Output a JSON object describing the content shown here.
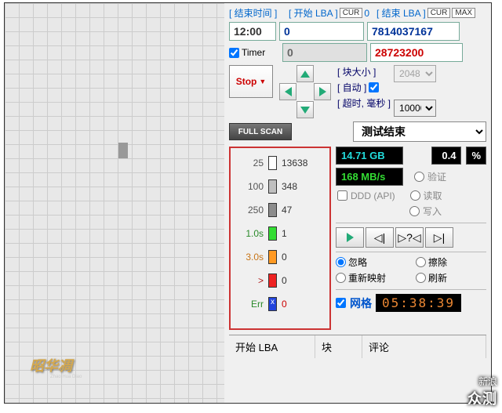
{
  "top": {
    "end_time_label": "[ 结束时间 ]",
    "start_lba_label": "[ 开始 LBA ]",
    "cur1": "CUR",
    "cur1_val": "0",
    "end_lba_label": "[ 结束 LBA ]",
    "cur2": "CUR",
    "max": "MAX"
  },
  "inputs": {
    "time": "12:00",
    "timer_label": "Timer",
    "timer_checked": true,
    "lba_start": "0",
    "lba_cur": "0",
    "lba_end": "7814037167",
    "lba_red": "28723200"
  },
  "ctrl": {
    "stop": "Stop",
    "block_size_label": "[ 块大小 ]",
    "block_size": "2048",
    "auto_label": "[ 自动 ]",
    "auto_checked": true,
    "timeout_label": "[ 超时, 毫秒 ]",
    "timeout": "10000",
    "full_scan": "FULL SCAN",
    "status": "测试结束"
  },
  "legend": [
    {
      "label": "25",
      "color": "#ffffff",
      "count": "13638"
    },
    {
      "label": "100",
      "color": "#bfbfbf",
      "count": "348"
    },
    {
      "label": "250",
      "color": "#8c8c8c",
      "count": "47"
    },
    {
      "label": "1.0s",
      "color": "#33dd33",
      "count": "1",
      "lc": "#2a8a2a"
    },
    {
      "label": "3.0s",
      "color": "#ff9922",
      "count": "0",
      "lc": "#c77518"
    },
    {
      "label": ">",
      "color": "#ee2222",
      "count": "0",
      "lc": "#b01515"
    },
    {
      "label": "Err",
      "color": "#2244dd",
      "count": "0",
      "lc": "#2a8a2a",
      "mark": "x",
      "cc": "#cc0000"
    }
  ],
  "stats": {
    "size": "14.71 GB",
    "pct": "0.4",
    "pct_sym": "%",
    "speed": "168 MB/s",
    "verify": "验证",
    "ddd_label": "DDD (API)",
    "read": "读取",
    "write": "写入"
  },
  "opts": {
    "ignore": "忽略",
    "erase": "擦除",
    "remap": "重新映射",
    "refresh": "刷新"
  },
  "grid_opt": {
    "label": "网格",
    "checked": true,
    "timer": "05:38:39"
  },
  "bottom": {
    "c1": "开始 LBA",
    "c2": "块",
    "c3": "评论"
  },
  "watermark": "昭华凋",
  "watermark_sub": "Zhao Hua Diao",
  "sina": {
    "l1": "新浪",
    "l2": "众测"
  }
}
